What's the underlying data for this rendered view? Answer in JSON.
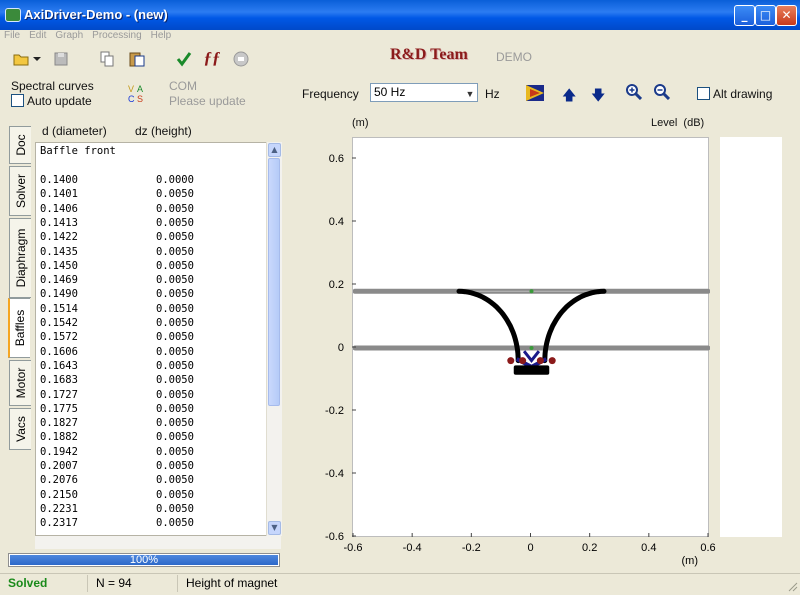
{
  "window": {
    "title": "AxiDriver-Demo - (new)",
    "minimize": "_",
    "maximize": "□",
    "close": "✕"
  },
  "menu": [
    "File",
    "Edit",
    "Graph",
    "Processing",
    "Help"
  ],
  "toolbar": {
    "icons": [
      "open-folder-icon",
      "save-icon",
      "copy-icon",
      "paste-icon",
      "check-icon",
      "function-icon",
      "stop-icon"
    ],
    "brand": "R&D Team",
    "edition": "DEMO"
  },
  "controls": {
    "spectral_label": "Spectral curves",
    "auto_update_label": "Auto update",
    "auto_update_checked": false,
    "com_label": "COM",
    "com_status": "Please update",
    "frequency_label": "Frequency",
    "frequency_value": "50 Hz",
    "frequency_unit": "Hz",
    "alt_drawing_label": "Alt drawing",
    "alt_drawing_checked": false
  },
  "tabs": [
    {
      "label": "Doc",
      "active": false
    },
    {
      "label": "Solver",
      "active": false
    },
    {
      "label": "Diaphragm",
      "active": false
    },
    {
      "label": "Baffles",
      "active": true
    },
    {
      "label": "Motor",
      "active": false
    },
    {
      "label": "Vacs",
      "active": false
    }
  ],
  "list": {
    "col1_header": "d (diameter)",
    "col2_header": "dz (height)",
    "section_title": "Baffle front",
    "rows": [
      [
        "0.1400",
        "0.0000"
      ],
      [
        "0.1401",
        "0.0050"
      ],
      [
        "0.1406",
        "0.0050"
      ],
      [
        "0.1413",
        "0.0050"
      ],
      [
        "0.1422",
        "0.0050"
      ],
      [
        "0.1435",
        "0.0050"
      ],
      [
        "0.1450",
        "0.0050"
      ],
      [
        "0.1469",
        "0.0050"
      ],
      [
        "0.1490",
        "0.0050"
      ],
      [
        "0.1514",
        "0.0050"
      ],
      [
        "0.1542",
        "0.0050"
      ],
      [
        "0.1572",
        "0.0050"
      ],
      [
        "0.1606",
        "0.0050"
      ],
      [
        "0.1643",
        "0.0050"
      ],
      [
        "0.1683",
        "0.0050"
      ],
      [
        "0.1727",
        "0.0050"
      ],
      [
        "0.1775",
        "0.0050"
      ],
      [
        "0.1827",
        "0.0050"
      ],
      [
        "0.1882",
        "0.0050"
      ],
      [
        "0.1942",
        "0.0050"
      ],
      [
        "0.2007",
        "0.0050"
      ],
      [
        "0.2076",
        "0.0050"
      ],
      [
        "0.2150",
        "0.0050"
      ],
      [
        "0.2231",
        "0.0050"
      ],
      [
        "0.2317",
        "0.0050"
      ]
    ]
  },
  "progress": {
    "value": 1.0,
    "text": "100%"
  },
  "status": {
    "state": "Solved",
    "state_color": "#1a8a1a",
    "count": "N = 94",
    "field": "Height of magnet"
  },
  "plot": {
    "y_unit": "(m)",
    "x_unit": "(m)",
    "level_label": "Level  (dB)",
    "y_ticks": [
      "0.6",
      "0.4",
      "0.2",
      "0",
      "-0.2",
      "-0.4",
      "-0.6"
    ],
    "x_ticks": [
      "-0.6",
      "-0.4",
      "-0.2",
      "0",
      "0.2",
      "0.4",
      "0.6"
    ],
    "y_tick_values": [
      0.6,
      0.4,
      0.2,
      0,
      -0.2,
      -0.4,
      -0.6
    ],
    "x_tick_values": [
      -0.6,
      -0.4,
      -0.2,
      0,
      0.2,
      0.4,
      0.6
    ],
    "baffle_levels": [
      0.18,
      0.0
    ],
    "colors": {
      "baffle": "#8a8a8a",
      "diaphragm": "#000000",
      "motor": "#1a1a8a",
      "joint": "#8b1a1a",
      "marker": "#3a9a3a"
    }
  }
}
